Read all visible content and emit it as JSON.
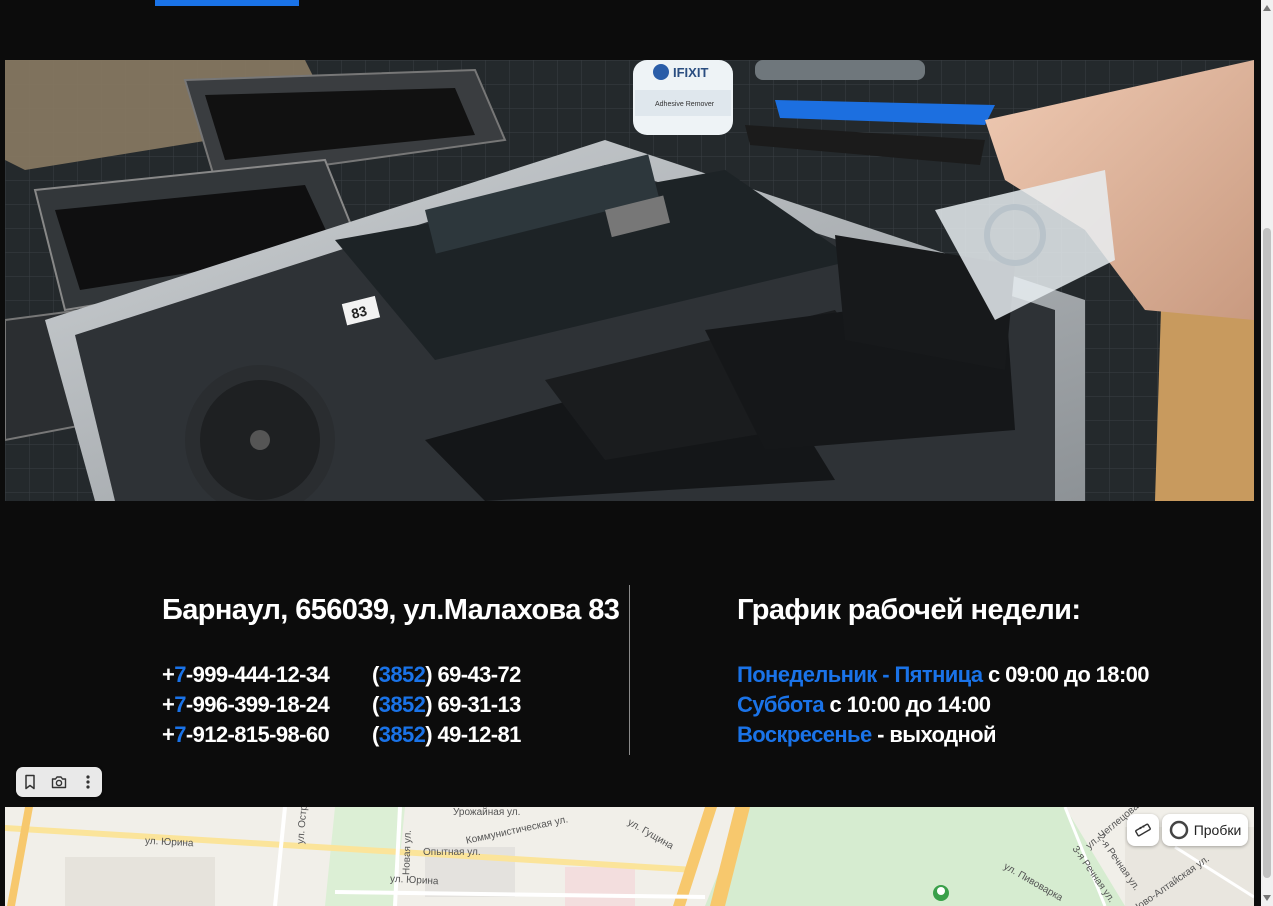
{
  "address": "Барнаул, 656039, ул.Малахова 83",
  "phones": [
    {
      "mobile_prefix": "+",
      "mobile_code": "7",
      "mobile_rest": "-999-444-12-34",
      "city_open": "(",
      "city_code": "3852",
      "city_rest": ") 69-43-72"
    },
    {
      "mobile_prefix": "+",
      "mobile_code": "7",
      "mobile_rest": "-996-399-18-24",
      "city_open": "(",
      "city_code": "3852",
      "city_rest": ") 69-31-13"
    },
    {
      "mobile_prefix": "+",
      "mobile_code": "7",
      "mobile_rest": "-912-815-98-60",
      "city_open": "(",
      "city_code": "3852",
      "city_rest": ") 49-12-81"
    }
  ],
  "schedule": {
    "title": "График рабочей недели:",
    "rows": [
      {
        "days": "Понедельник - Пятница",
        "hours": " с 09:00 до 18:00"
      },
      {
        "days": "Суббота",
        "hours": " с 10:00 до 14:00"
      },
      {
        "days": "Воскресенье",
        "hours": " - выходной"
      }
    ]
  },
  "hero": {
    "bottle_brand": "IFIXIT",
    "bottle_label": "Adhesive Remover",
    "board_sticker": "83"
  },
  "map": {
    "traffic_label": "Пробки",
    "streets": [
      "Урожайная ул.",
      "ул. Юрина",
      "Коммунистическая ул.",
      "Опытная ул.",
      "ул. Юрина",
      "ул. Гущина",
      "Новая ул.",
      "ул. Остр",
      "ул. Чеглецова",
      "2-я Речная ул.",
      "3-я Речная ул.",
      "Ново-Алтайская ул.",
      "ул. Пивоварка"
    ]
  },
  "icons": {
    "bookmark": "bookmark-icon",
    "screenshot": "camera-icon",
    "more": "more-vertical-icon",
    "ruler": "ruler-icon",
    "traffic": "traffic-icon"
  },
  "colors": {
    "accent": "#1a73e8",
    "background": "#0c0c0c",
    "text": "#ffffff"
  }
}
